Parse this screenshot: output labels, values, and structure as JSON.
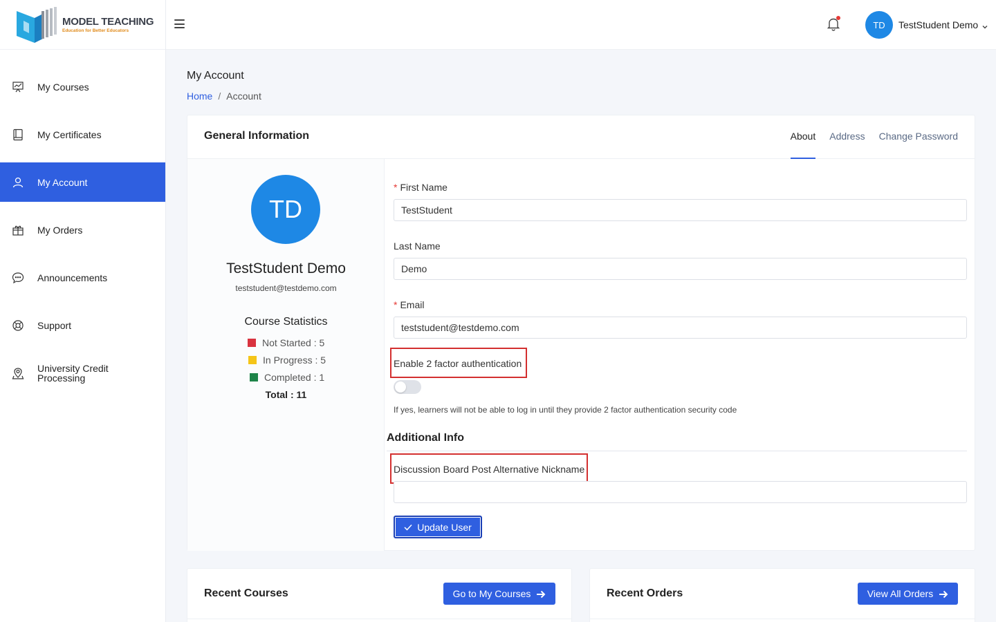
{
  "brand": {
    "name": "MODEL TEACHING",
    "tagline": "Education for Better Educators"
  },
  "sidebar": {
    "items": [
      {
        "label": "My Courses",
        "icon": "presentation-chart-icon"
      },
      {
        "label": "My Certificates",
        "icon": "book-icon"
      },
      {
        "label": "My Account",
        "icon": "user-icon",
        "active": true
      },
      {
        "label": "My Orders",
        "icon": "gift-box-icon"
      },
      {
        "label": "Announcements",
        "icon": "chat-bubble-icon"
      },
      {
        "label": "Support",
        "icon": "lifebuoy-icon"
      },
      {
        "label": "University Credit Processing",
        "icon": "map-pin-icon"
      }
    ]
  },
  "topbar": {
    "user_initials": "TD",
    "user_name": "TestStudent Demo"
  },
  "page": {
    "title": "My Account",
    "breadcrumb": [
      "Home",
      "Account"
    ]
  },
  "card": {
    "title": "General Information",
    "tabs": [
      "About",
      "Address",
      "Change Password"
    ],
    "active_tab": "About"
  },
  "profile": {
    "initials": "TD",
    "name": "TestStudent Demo",
    "email": "teststudent@testdemo.com",
    "stats_title": "Course Statistics",
    "stats": [
      {
        "label": "Not Started : 5",
        "color": "#d9333f"
      },
      {
        "label": "In Progress : 5",
        "color": "#f5c518"
      },
      {
        "label": "Completed : 1",
        "color": "#1e8449"
      }
    ],
    "total": "Total : 11"
  },
  "form": {
    "first_name_label": "First Name",
    "first_name_value": "TestStudent",
    "last_name_label": "Last Name",
    "last_name_value": "Demo",
    "email_label": "Email",
    "email_value": "teststudent@testdemo.com",
    "two_factor_label": "Enable 2 factor authentication",
    "two_factor_enabled": false,
    "two_factor_help": "If yes, learners will not be able to log in until they provide 2 factor authentication security code",
    "additional_title": "Additional Info",
    "nickname_label": "Discussion Board Post Alternative Nickname",
    "nickname_value": "",
    "submit_label": "Update User"
  },
  "recent_courses": {
    "title": "Recent Courses",
    "button": "Go to My Courses"
  },
  "recent_orders": {
    "title": "Recent Orders",
    "button": "View All Orders"
  },
  "colors": {
    "primary": "#2f5fe0",
    "avatar": "#1e88e5",
    "highlight": "#d32f2f"
  }
}
